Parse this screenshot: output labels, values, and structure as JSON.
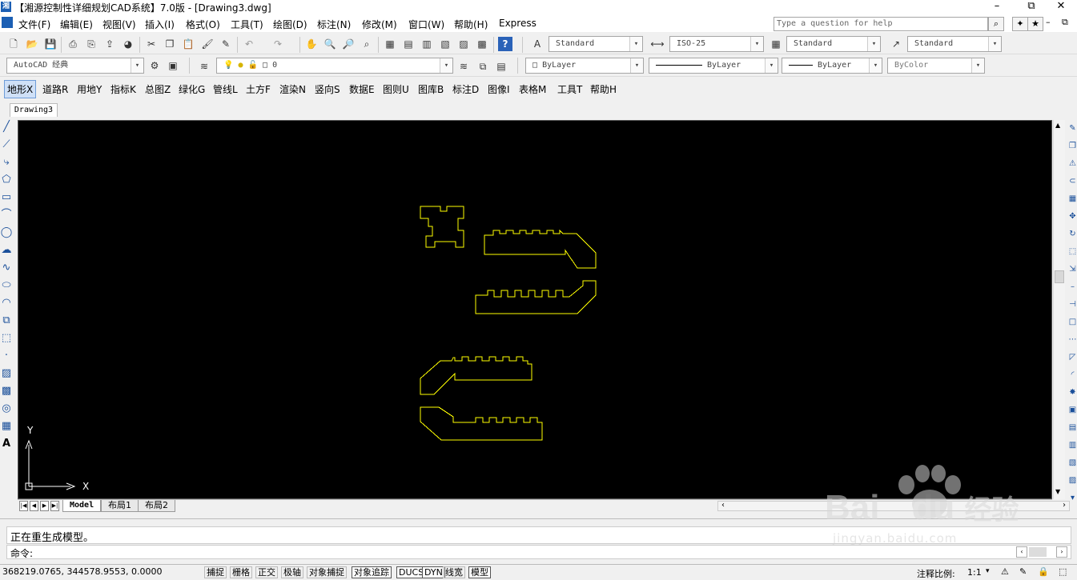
{
  "title_bar": {
    "logo_text": "湘",
    "title": "【湘源控制性详细规划CAD系统】7.0版 - [Drawing3.dwg]",
    "minimize": "–",
    "restore": "⧉",
    "close": "✕"
  },
  "menu": {
    "items": [
      "文件(F)",
      "编辑(E)",
      "视图(V)",
      "插入(I)",
      "格式(O)",
      "工具(T)",
      "绘图(D)",
      "标注(N)",
      "修改(M)",
      "窗口(W)",
      "帮助(H)",
      "Express"
    ],
    "help_placeholder": "Type a question for help"
  },
  "toolbar_styles": {
    "text_style": "Standard",
    "dim_style": "ISO-25",
    "table_style": "Standard",
    "multileader_style": "Standard"
  },
  "toolbar_layers": {
    "workspace": "AutoCAD 经典",
    "layer": "0",
    "color": "ByLayer",
    "linetype": "ByLayer",
    "lineweight": "ByLayer",
    "plotstyle": "ByColor"
  },
  "custom_menu": {
    "items": [
      "地形X",
      "道路R",
      "用地Y",
      "指标K",
      "总图Z",
      "绿化G",
      "管线L",
      "土方F",
      "渲染N",
      "竖向S",
      "数据E",
      "图则U",
      "图库B",
      "标注D",
      "图像I",
      "表格M",
      "工具T",
      "帮助H"
    ],
    "active_index": 0
  },
  "drawing_tab": "Drawing3",
  "ucs": {
    "x_label": "X",
    "y_label": "Y"
  },
  "layout_tabs": [
    "Model",
    "布局1",
    "布局2"
  ],
  "command": {
    "history": "正在重生成模型。",
    "prompt": "命令:"
  },
  "status": {
    "coordinates": "368219.0765, 344578.9553, 0.0000",
    "toggles": [
      {
        "label": "捕捉",
        "on": false
      },
      {
        "label": "栅格",
        "on": false
      },
      {
        "label": "正交",
        "on": false
      },
      {
        "label": "极轴",
        "on": false
      },
      {
        "label": "对象捕捉",
        "on": false
      },
      {
        "label": "对象追踪",
        "on": true
      },
      {
        "label": "DUCS",
        "on": true
      },
      {
        "label": "DYN",
        "on": true
      },
      {
        "label": "线宽",
        "on": false
      },
      {
        "label": "模型",
        "on": true
      }
    ],
    "annotation_scale_label": "注释比例:",
    "annotation_scale": "1:1"
  },
  "watermark": {
    "brand": "Bai",
    "brand2": "du",
    "suffix": "经验",
    "url": "jingyan.baidu.com"
  },
  "colors": {
    "canvas_bg": "#000000",
    "geometry_stroke": "#ffff00",
    "ucs_icon": "#ffffff",
    "active_menu_bg": "#cfe0f7"
  },
  "icons": {
    "left_toolbar": [
      "line-icon",
      "construction-line-icon",
      "polyline-icon",
      "polygon-icon",
      "rectangle-icon",
      "arc-icon",
      "circle-icon",
      "revision-cloud-icon",
      "spline-icon",
      "ellipse-icon",
      "ellipse-arc-icon",
      "insert-block-icon",
      "make-block-icon",
      "point-icon",
      "hatch-icon",
      "gradient-icon",
      "region-icon",
      "table-icon",
      "multiline-text-icon"
    ],
    "right_toolbar": [
      "erase-icon",
      "copy-icon",
      "mirror-icon",
      "offset-icon",
      "array-icon",
      "move-icon",
      "rotate-icon",
      "scale-icon",
      "stretch-icon",
      "trim-icon",
      "extend-icon",
      "break-icon",
      "join-icon",
      "chamfer-icon",
      "fillet-icon",
      "explode-icon"
    ]
  }
}
